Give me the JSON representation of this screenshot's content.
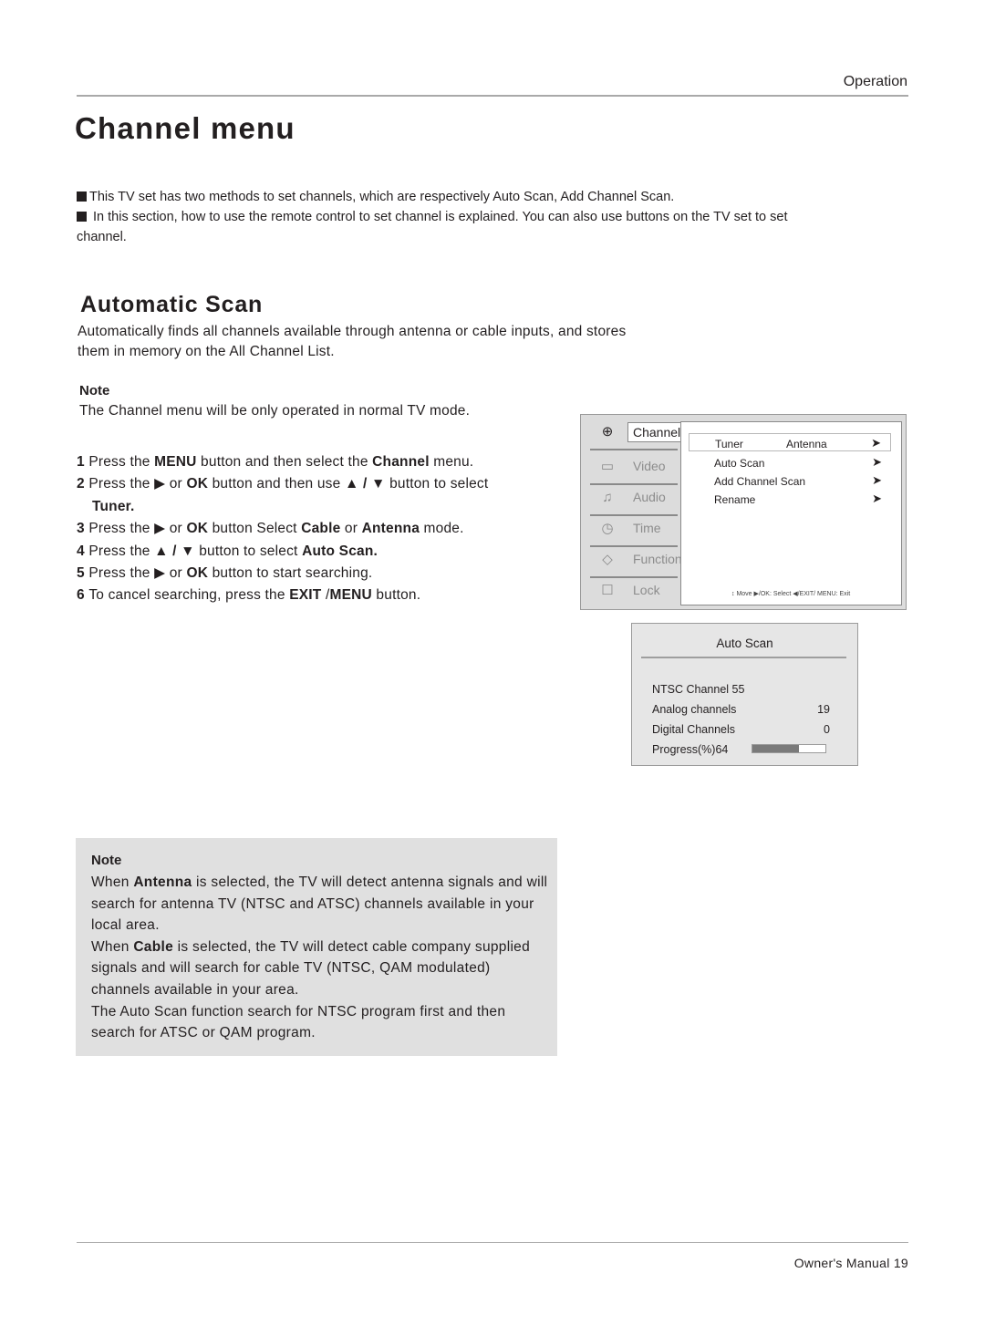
{
  "header": {
    "section": "Operation",
    "title": "Channel menu"
  },
  "intro": [
    "This TV set has two methods to set channels, which are respectively Auto Scan,  Add Channel Scan.",
    " In this section, how to use the remote control  to set channel is explained. You can also use buttons on the TV set to set channel."
  ],
  "automatic_scan": {
    "title": "Automatic Scan",
    "description": "Automatically finds all channels available through antenna or cable inputs, and stores them in memory on the All Channel List.",
    "note_label": "Note",
    "note_text": "The Channel menu will be only operated  in normal TV mode."
  },
  "steps": [
    {
      "num": "1",
      "parts": [
        [
          "Press the ",
          false
        ],
        [
          "MENU",
          true
        ],
        [
          " button and then select the ",
          false
        ],
        [
          "Channel",
          true
        ],
        [
          " menu.",
          false
        ]
      ]
    },
    {
      "num": "2",
      "parts": [
        [
          "Press the ",
          false
        ],
        [
          "▶",
          false
        ],
        [
          " or ",
          false
        ],
        [
          "OK",
          true
        ],
        [
          " button and then use ",
          false
        ],
        [
          "▲ / ▼",
          true
        ],
        [
          " button to select",
          false
        ]
      ],
      "cont": "Tuner."
    },
    {
      "num": "3",
      "parts": [
        [
          "Press the ",
          false
        ],
        [
          "▶",
          false
        ],
        [
          " or ",
          false
        ],
        [
          "OK",
          true
        ],
        [
          " button  Select ",
          false
        ],
        [
          "Cable",
          true
        ],
        [
          " or ",
          false
        ],
        [
          "Antenna",
          true
        ],
        [
          "  mode.",
          false
        ]
      ]
    },
    {
      "num": "4",
      "parts": [
        [
          "Press the  ",
          false
        ],
        [
          "▲ / ▼",
          true
        ],
        [
          " button to select  ",
          false
        ],
        [
          "Auto Scan.",
          true
        ]
      ]
    },
    {
      "num": "5",
      "parts": [
        [
          "Press the ",
          false
        ],
        [
          "▶",
          false
        ],
        [
          "  or ",
          false
        ],
        [
          "OK",
          true
        ],
        [
          "  button to start searching.",
          false
        ]
      ]
    },
    {
      "num": "6",
      "parts": [
        [
          "To cancel searching, press the ",
          false
        ],
        [
          "EXIT",
          true
        ],
        [
          " /",
          false
        ],
        [
          "MENU",
          true
        ],
        [
          " button.",
          false
        ]
      ]
    }
  ],
  "tv_menu": {
    "sidebar": [
      {
        "label": "Channel",
        "icon": "antenna-icon",
        "glyph": "⊕",
        "active": true
      },
      {
        "label": "Video",
        "icon": "monitor-icon",
        "glyph": "▭"
      },
      {
        "label": "Audio",
        "icon": "audio-icon",
        "glyph": "♫"
      },
      {
        "label": "Time",
        "icon": "clock-icon",
        "glyph": "◷"
      },
      {
        "label": "Function",
        "icon": "function-icon",
        "glyph": "◇"
      },
      {
        "label": "Lock",
        "icon": "lock-icon",
        "glyph": "☐"
      }
    ],
    "items": [
      {
        "label": "Tuner",
        "value": "Antenna",
        "arrow": "➤",
        "selected": true
      },
      {
        "label": "Auto Scan",
        "value": "",
        "arrow": "➤"
      },
      {
        "label": "Add Channel Scan",
        "value": "",
        "arrow": "➤"
      },
      {
        "label": "Rename",
        "value": "",
        "arrow": "➤"
      }
    ],
    "help": "↕ Move  ▶/OK: Select  ◀/EXIT/ MENU: Exit"
  },
  "auto_scan_dialog": {
    "title": "Auto Scan",
    "channel": "NTSC Channel 55",
    "analog_label": "Analog channels",
    "analog_value": "19",
    "digital_label": "Digital Channels",
    "digital_value": "0",
    "progress_label": "Progress(%)64",
    "progress_percent": 64
  },
  "note_box": {
    "label": "Note",
    "paragraphs": [
      [
        [
          "When ",
          false
        ],
        [
          "Antenna",
          true
        ],
        [
          "  is selected, the TV will detect antenna signals and will search for antenna TV (NTSC and ATSC) channels available in your local area.",
          false
        ]
      ],
      [
        [
          "When ",
          false
        ],
        [
          "Cable",
          true
        ],
        [
          " is selected, the TV will detect cable company supplied signals and will search for cable TV (NTSC, QAM modulated) channels available in your area.",
          false
        ]
      ],
      [
        [
          "The Auto Scan function search for NTSC program first and then search for ATSC or QAM program.",
          false
        ]
      ]
    ]
  },
  "footer": {
    "text": "Owner's Manual  19"
  }
}
